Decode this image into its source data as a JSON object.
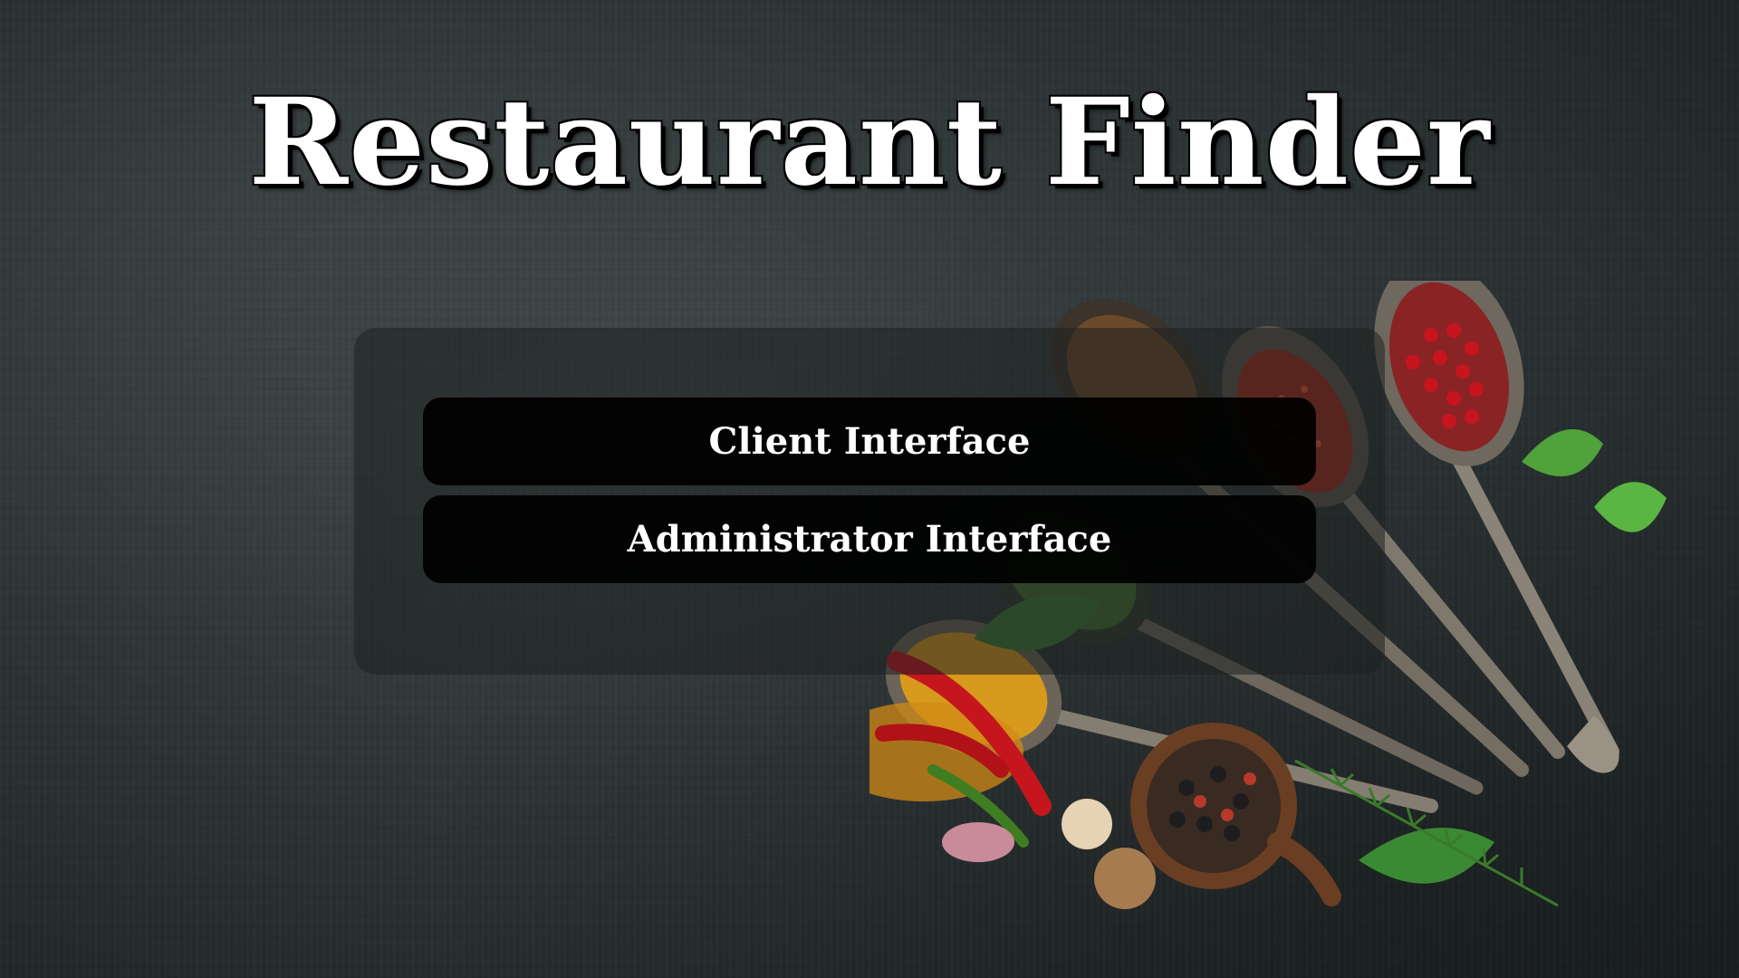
{
  "app": {
    "title": "Restaurant Finder"
  },
  "menu": {
    "client_label": "Client Interface",
    "admin_label": "Administrator Interface"
  },
  "background": {
    "image": "spices-on-chalkboard",
    "base_color": "#2f3637"
  },
  "colors": {
    "button_bg": "#000000",
    "button_text": "#ffffff",
    "title_text": "#ffffff"
  }
}
